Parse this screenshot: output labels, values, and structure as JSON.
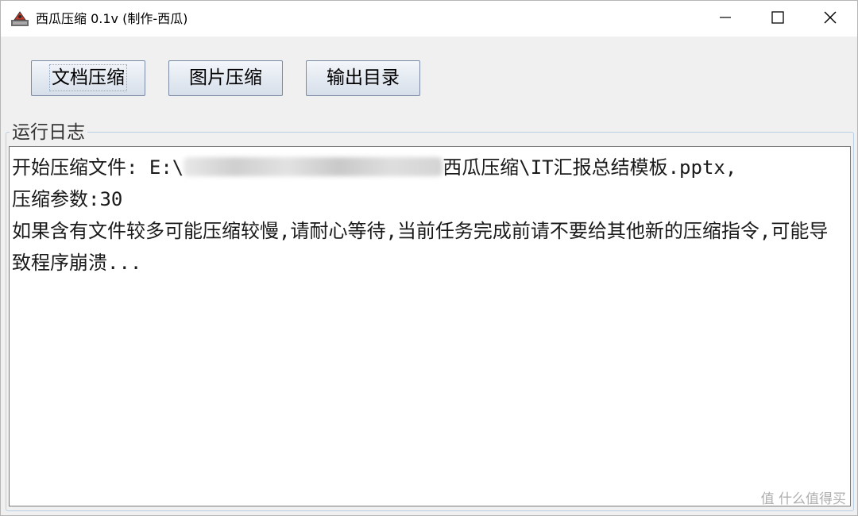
{
  "window": {
    "title": "西瓜压缩 0.1v (制作-西瓜)",
    "controls": {
      "minimize_icon": "minimize-icon",
      "maximize_icon": "maximize-icon",
      "close_icon": "close-icon"
    }
  },
  "toolbar": {
    "compress_document_label": "文档压缩",
    "compress_image_label": "图片压缩",
    "output_directory_label": "输出目录"
  },
  "log": {
    "group_title": "运行日志",
    "line1_prefix": "开始压缩文件: E:\\",
    "line1_suffix": "西瓜压缩\\IT汇报总结模板.pptx,",
    "line2": "压缩参数:30",
    "line3": "如果含有文件较多可能压缩较慢,请耐心等待,当前任务完成前请不要给其他新的压缩指令,可能导致程序崩溃..."
  },
  "watermark": "值 什么值得买",
  "colors": {
    "button_border": "#7a8ba3",
    "group_border": "#b8cfe5",
    "window_bg": "#f0f0f0"
  }
}
